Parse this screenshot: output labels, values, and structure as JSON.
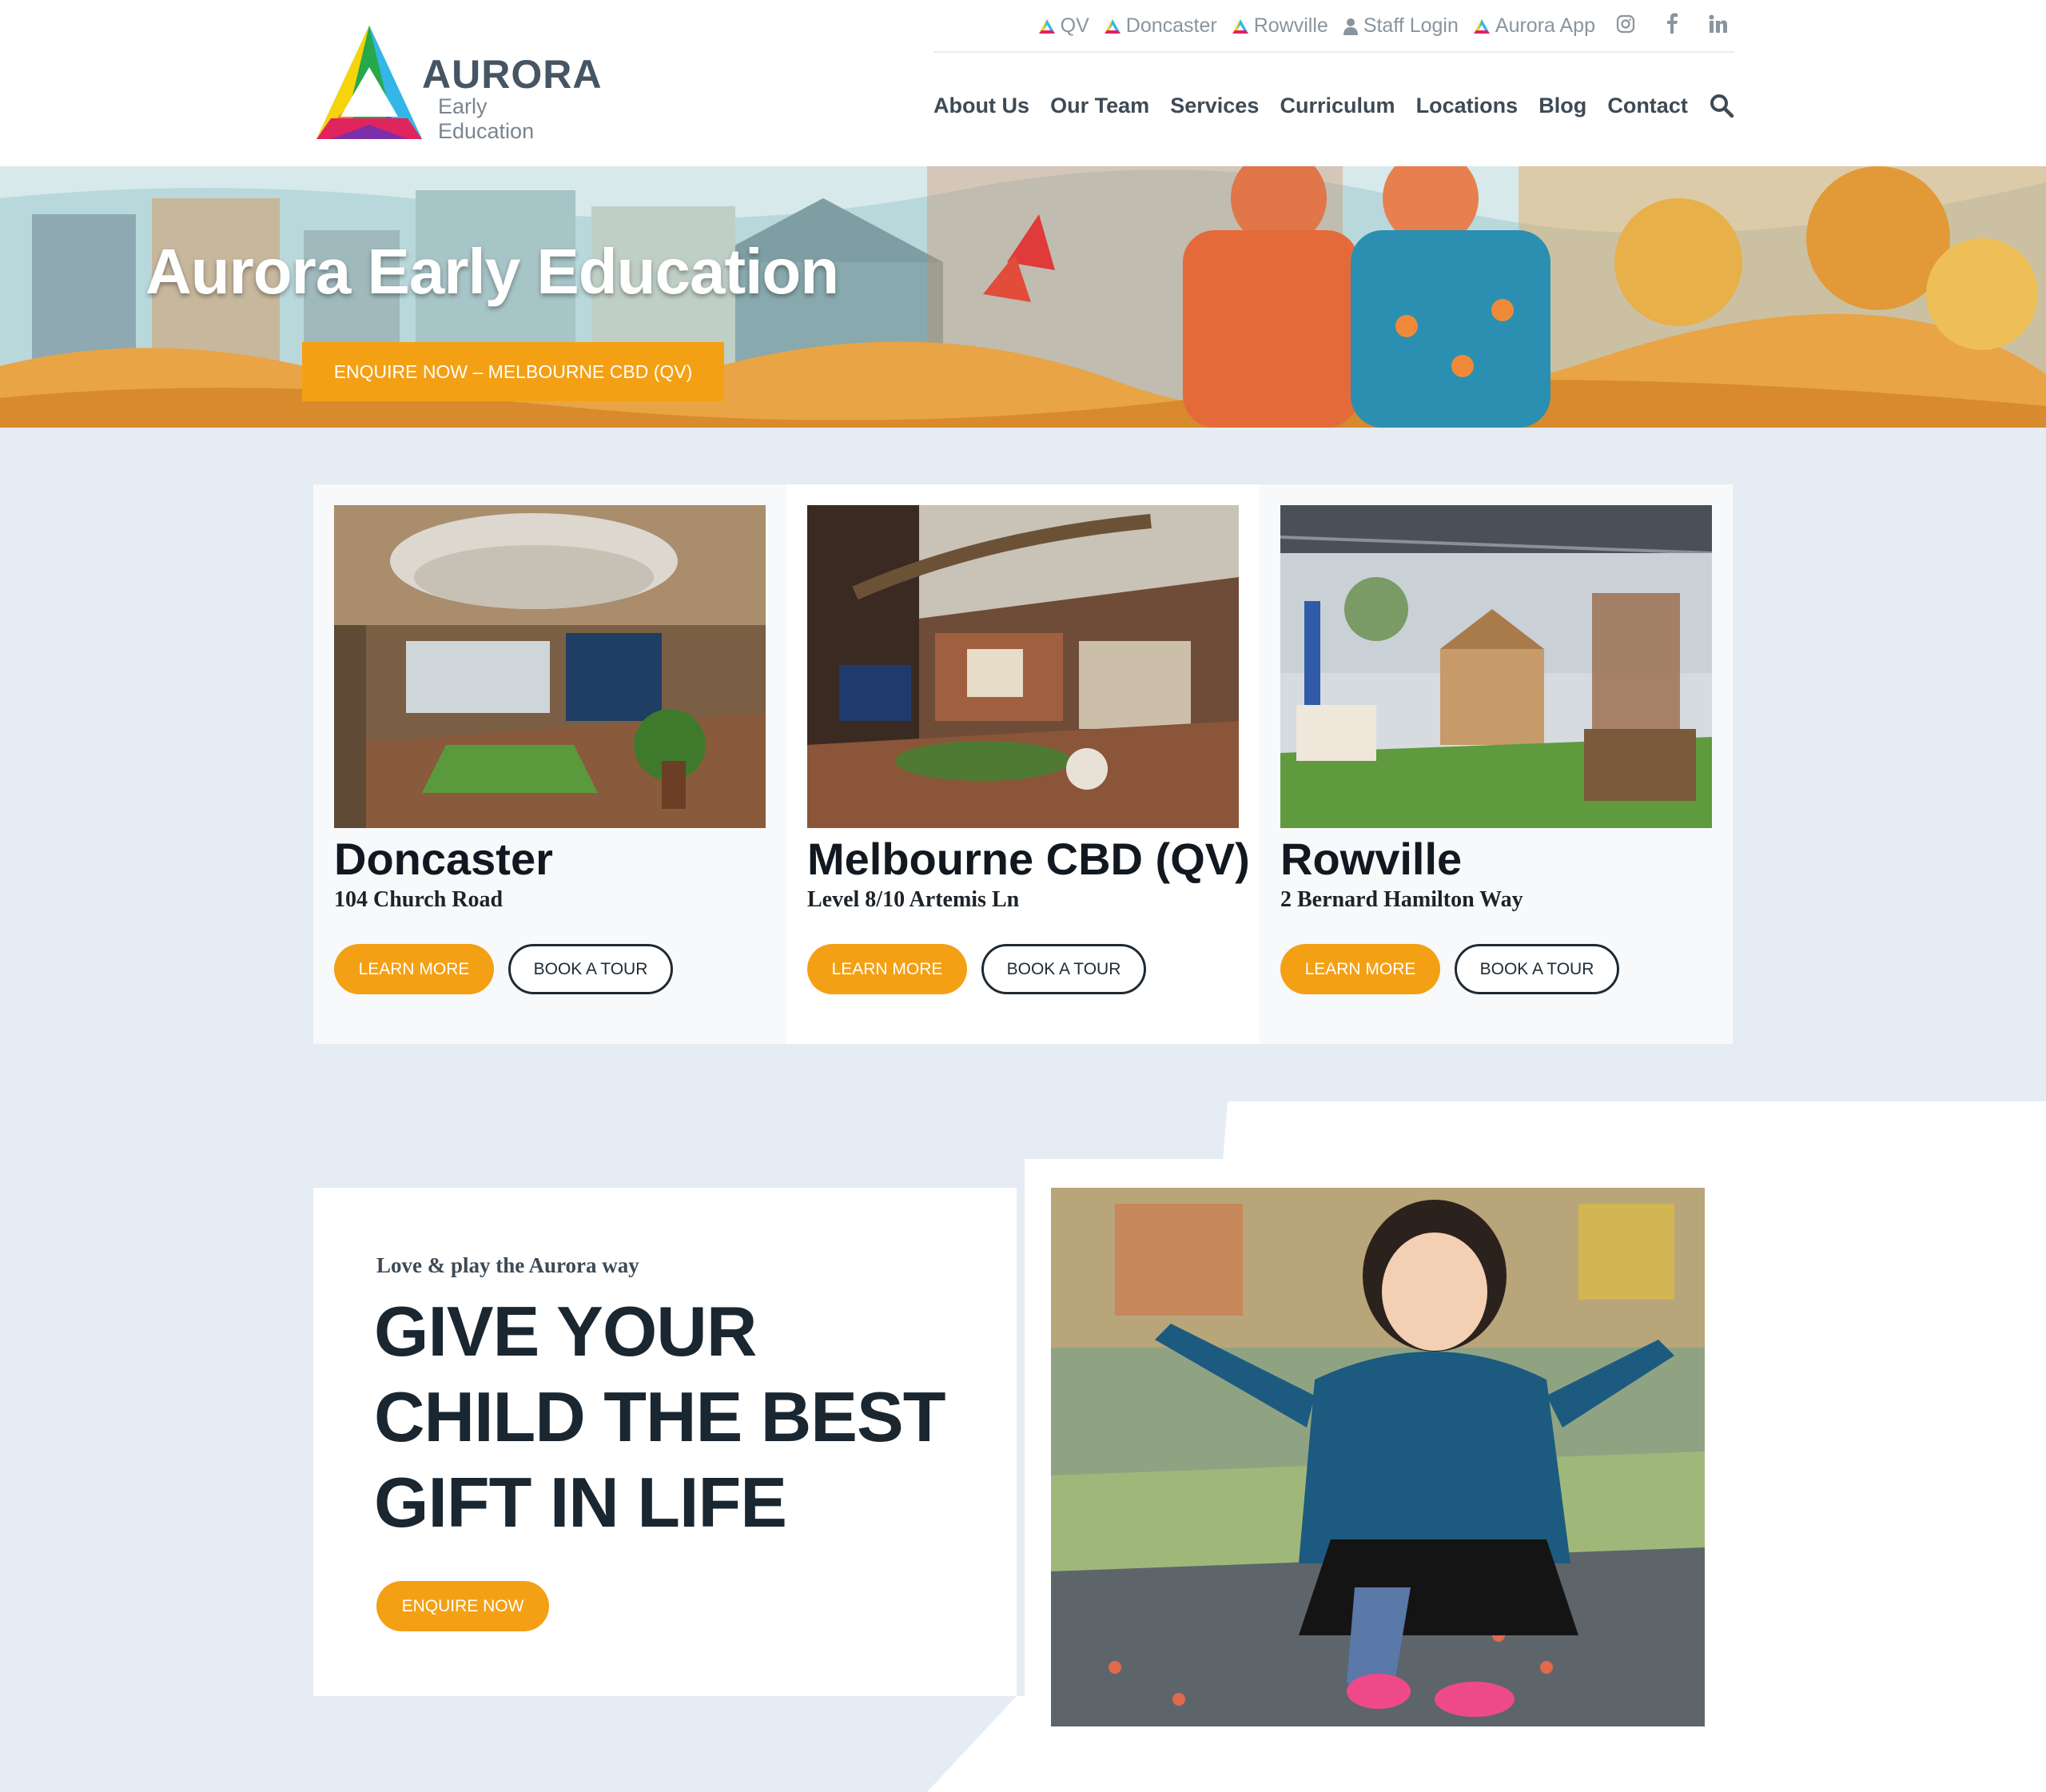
{
  "brand": {
    "name": "AURORA",
    "subtitle": "Early Education"
  },
  "topbar": {
    "links": [
      "QV",
      "Doncaster",
      "Rowville",
      "Staff Login",
      "Aurora App"
    ],
    "social": [
      "instagram-icon",
      "facebook-icon",
      "linkedin-icon"
    ]
  },
  "nav": {
    "items": [
      "About Us",
      "Our Team",
      "Services",
      "Curriculum",
      "Locations",
      "Blog",
      "Contact"
    ]
  },
  "hero": {
    "title": "Aurora Early Education",
    "cta": "ENQUIRE NOW – MELBOURNE CBD (QV)"
  },
  "locations": [
    {
      "name": "Doncaster",
      "address": "104 Church Road",
      "learn": "LEARN MORE",
      "tour": "BOOK A TOUR"
    },
    {
      "name": "Melbourne CBD (QV)",
      "address": "Level 8/10 Artemis Ln",
      "learn": "LEARN MORE",
      "tour": "BOOK A TOUR"
    },
    {
      "name": "Rowville",
      "address": "2 Bernard Hamilton Way",
      "learn": "LEARN MORE",
      "tour": "BOOK A TOUR"
    }
  ],
  "promo": {
    "eyebrow": "Love & play the Aurora way",
    "headline": "GIVE YOUR CHILD THE BEST GIFT IN LIFE",
    "cta": "ENQUIRE NOW"
  },
  "colors": {
    "accent": "#f4a014",
    "dark": "#1f2a33",
    "page_bg": "#e6ecf3"
  }
}
